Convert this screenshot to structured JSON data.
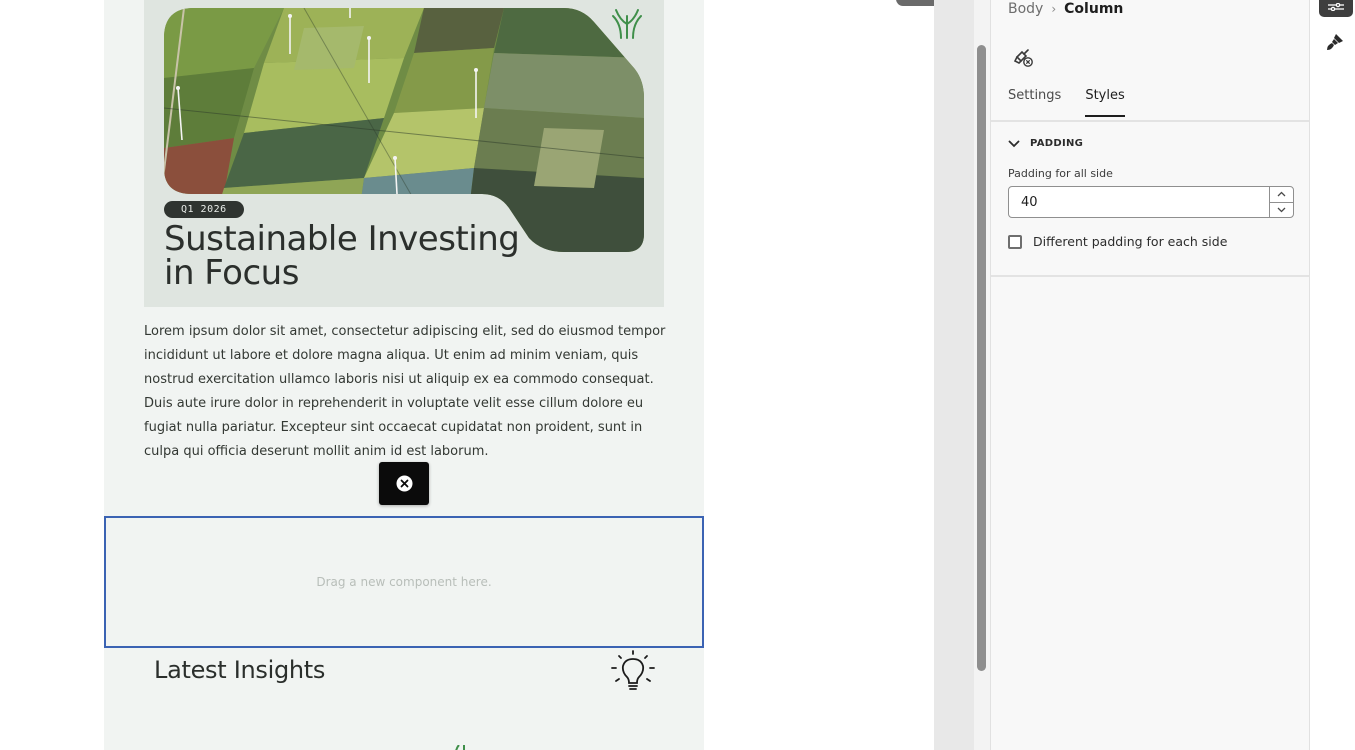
{
  "email": {
    "hero": {
      "tag": "Q1 2026",
      "title_line1": "Sustainable Investing",
      "title_line2": "in Focus"
    },
    "paragraph": "Lorem ipsum dolor sit amet, consectetur adipiscing elit, sed do eiusmod tempor incididunt ut labore et dolore magna aliqua. Ut enim ad minim veniam, quis nostrud exercitation ullamco laboris nisi ut aliquip ex ea commodo consequat. Duis aute irure dolor in reprehenderit in voluptate velit esse cillum dolore eu fugiat nulla pariatur. Excepteur sint occaecat cupidatat non proident, sunt in culpa qui officia deserunt mollit anim id est laborum.",
    "dropzone_text": "Drag a new component here.",
    "insights_title": "Latest Insights"
  },
  "panel": {
    "breadcrumb": {
      "parent": "Body",
      "separator": "›",
      "current": "Column"
    },
    "tabs": [
      {
        "label": "Settings",
        "active": false
      },
      {
        "label": "Styles",
        "active": true
      }
    ],
    "section": {
      "title": "PADDING",
      "field_label": "Padding for all side",
      "field_value": "40",
      "checkbox_label": "Different padding for each side",
      "checkbox_checked": false
    }
  },
  "icons": {
    "remove": "close-circle-icon",
    "clear_style": "brush-clear-icon",
    "rail_active": "sliders-icon",
    "rail_style": "paint-brush-icon",
    "chevron": "chevron-down-icon",
    "bulb": "lightbulb-icon",
    "logo": "wheat-logo-icon"
  },
  "colors": {
    "selection_border": "#3b63b3",
    "email_background": "#f1f4f2",
    "hero_background": "#dfe5e0",
    "brand_green": "#3f8f4a"
  }
}
